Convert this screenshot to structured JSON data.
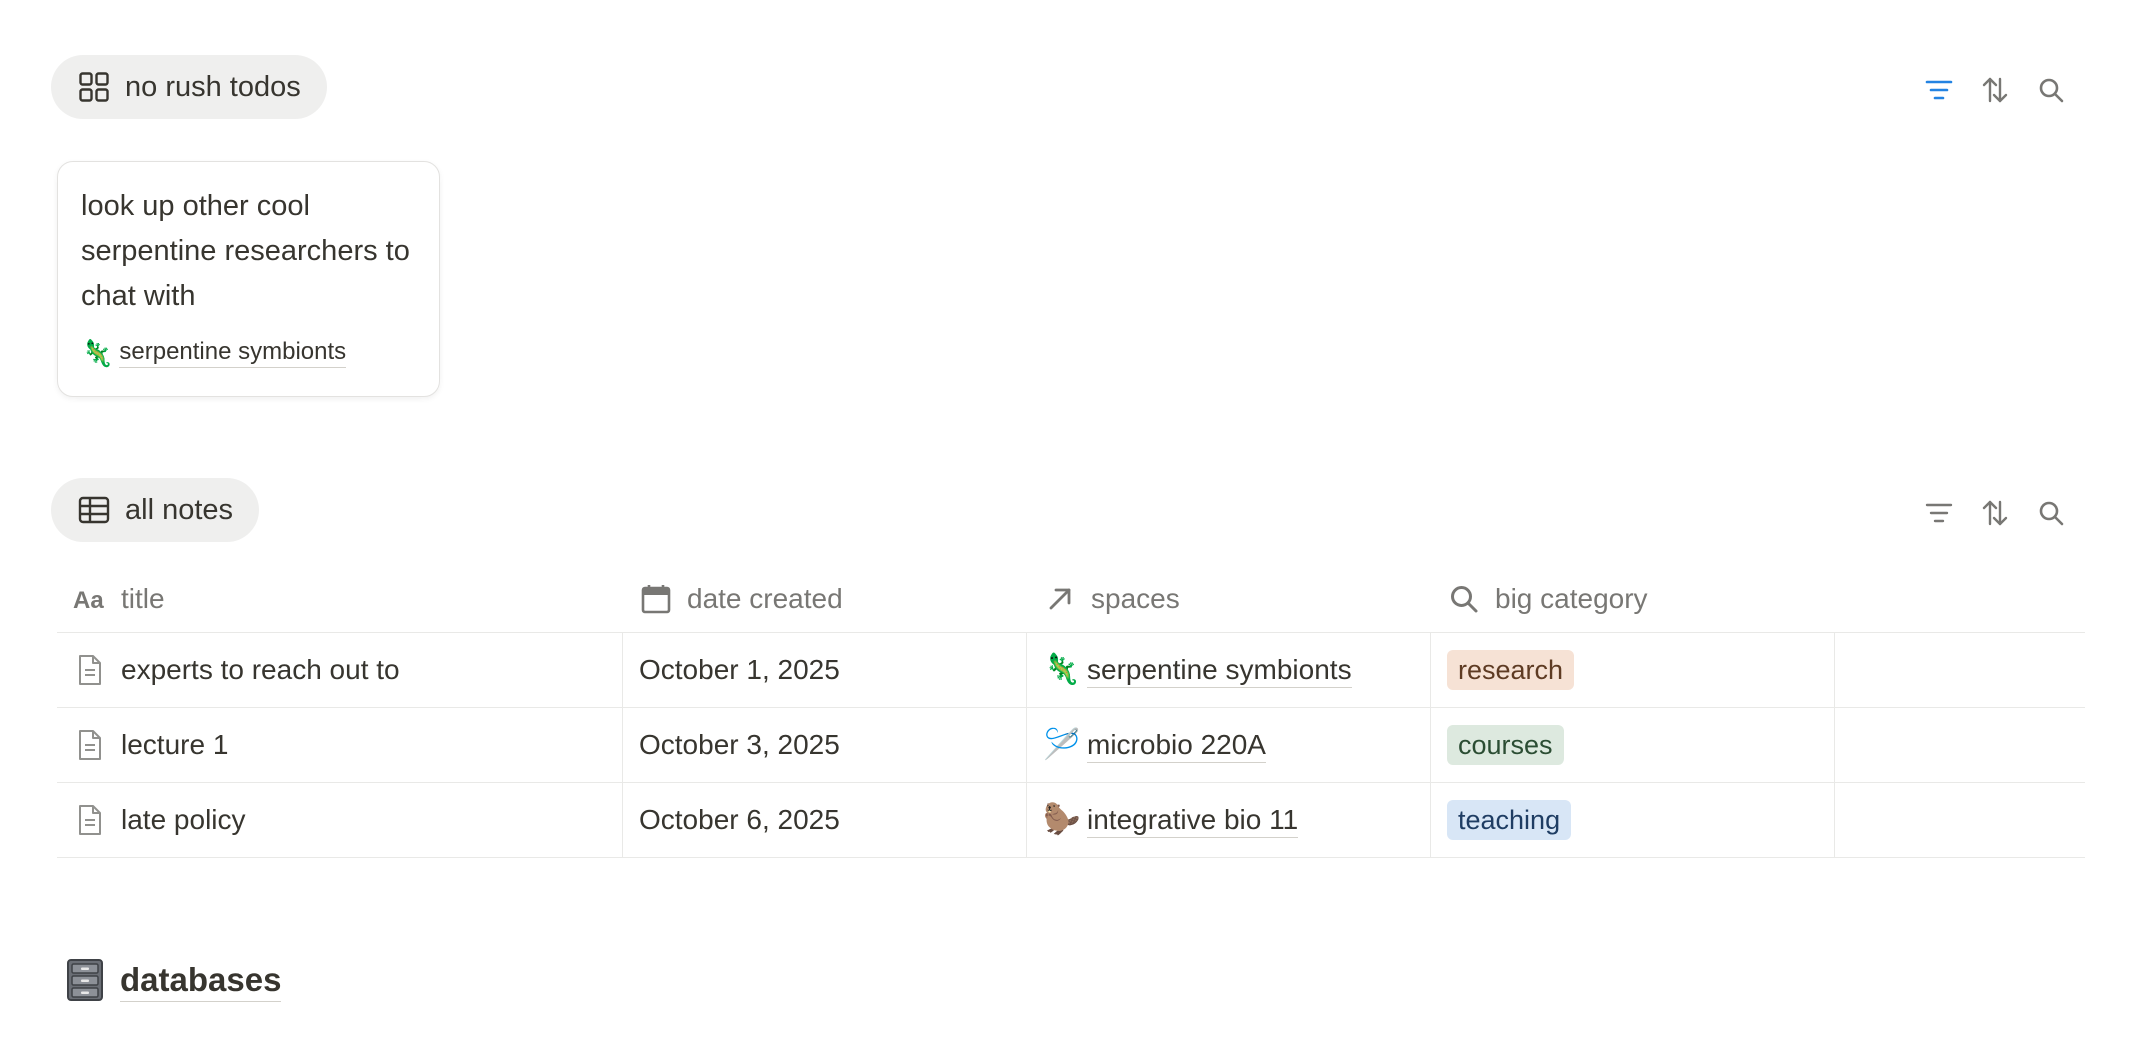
{
  "board_view": {
    "label": "no rush todos",
    "icon": "grid-icon",
    "toolbar": {
      "filter_icon": "filter-icon",
      "filter_active_color": "#2383e2",
      "sort_icon": "sort-icon",
      "search_icon": "search-icon"
    },
    "cards": [
      {
        "title": "look up other cool serpentine researchers to chat with",
        "space": {
          "emoji": "🦎",
          "name": "serpentine symbionts"
        }
      }
    ]
  },
  "table_view": {
    "label": "all notes",
    "icon": "table-icon",
    "toolbar": {
      "filter_icon": "filter-icon",
      "sort_icon": "sort-icon",
      "search_icon": "search-icon"
    },
    "columns": [
      {
        "label": "title",
        "icon": "text-property-icon"
      },
      {
        "label": "date created",
        "icon": "calendar-icon"
      },
      {
        "label": "spaces",
        "icon": "relation-arrow-icon"
      },
      {
        "label": "big category",
        "icon": "search-icon"
      }
    ],
    "rows": [
      {
        "title": "experts to reach out to",
        "date": "October 1, 2025",
        "space_emoji": "🦎",
        "space": "serpentine symbionts",
        "category": "research"
      },
      {
        "title": "lecture 1",
        "date": "October 3, 2025",
        "space_emoji": "🪡",
        "space": "microbio 220A",
        "category": "courses"
      },
      {
        "title": "late policy",
        "date": "October 6, 2025",
        "space_emoji": "🦫",
        "space": "integrative bio 11",
        "category": "teaching"
      }
    ]
  },
  "databases_heading": {
    "label": "databases",
    "icon": "file-cabinet-icon"
  }
}
